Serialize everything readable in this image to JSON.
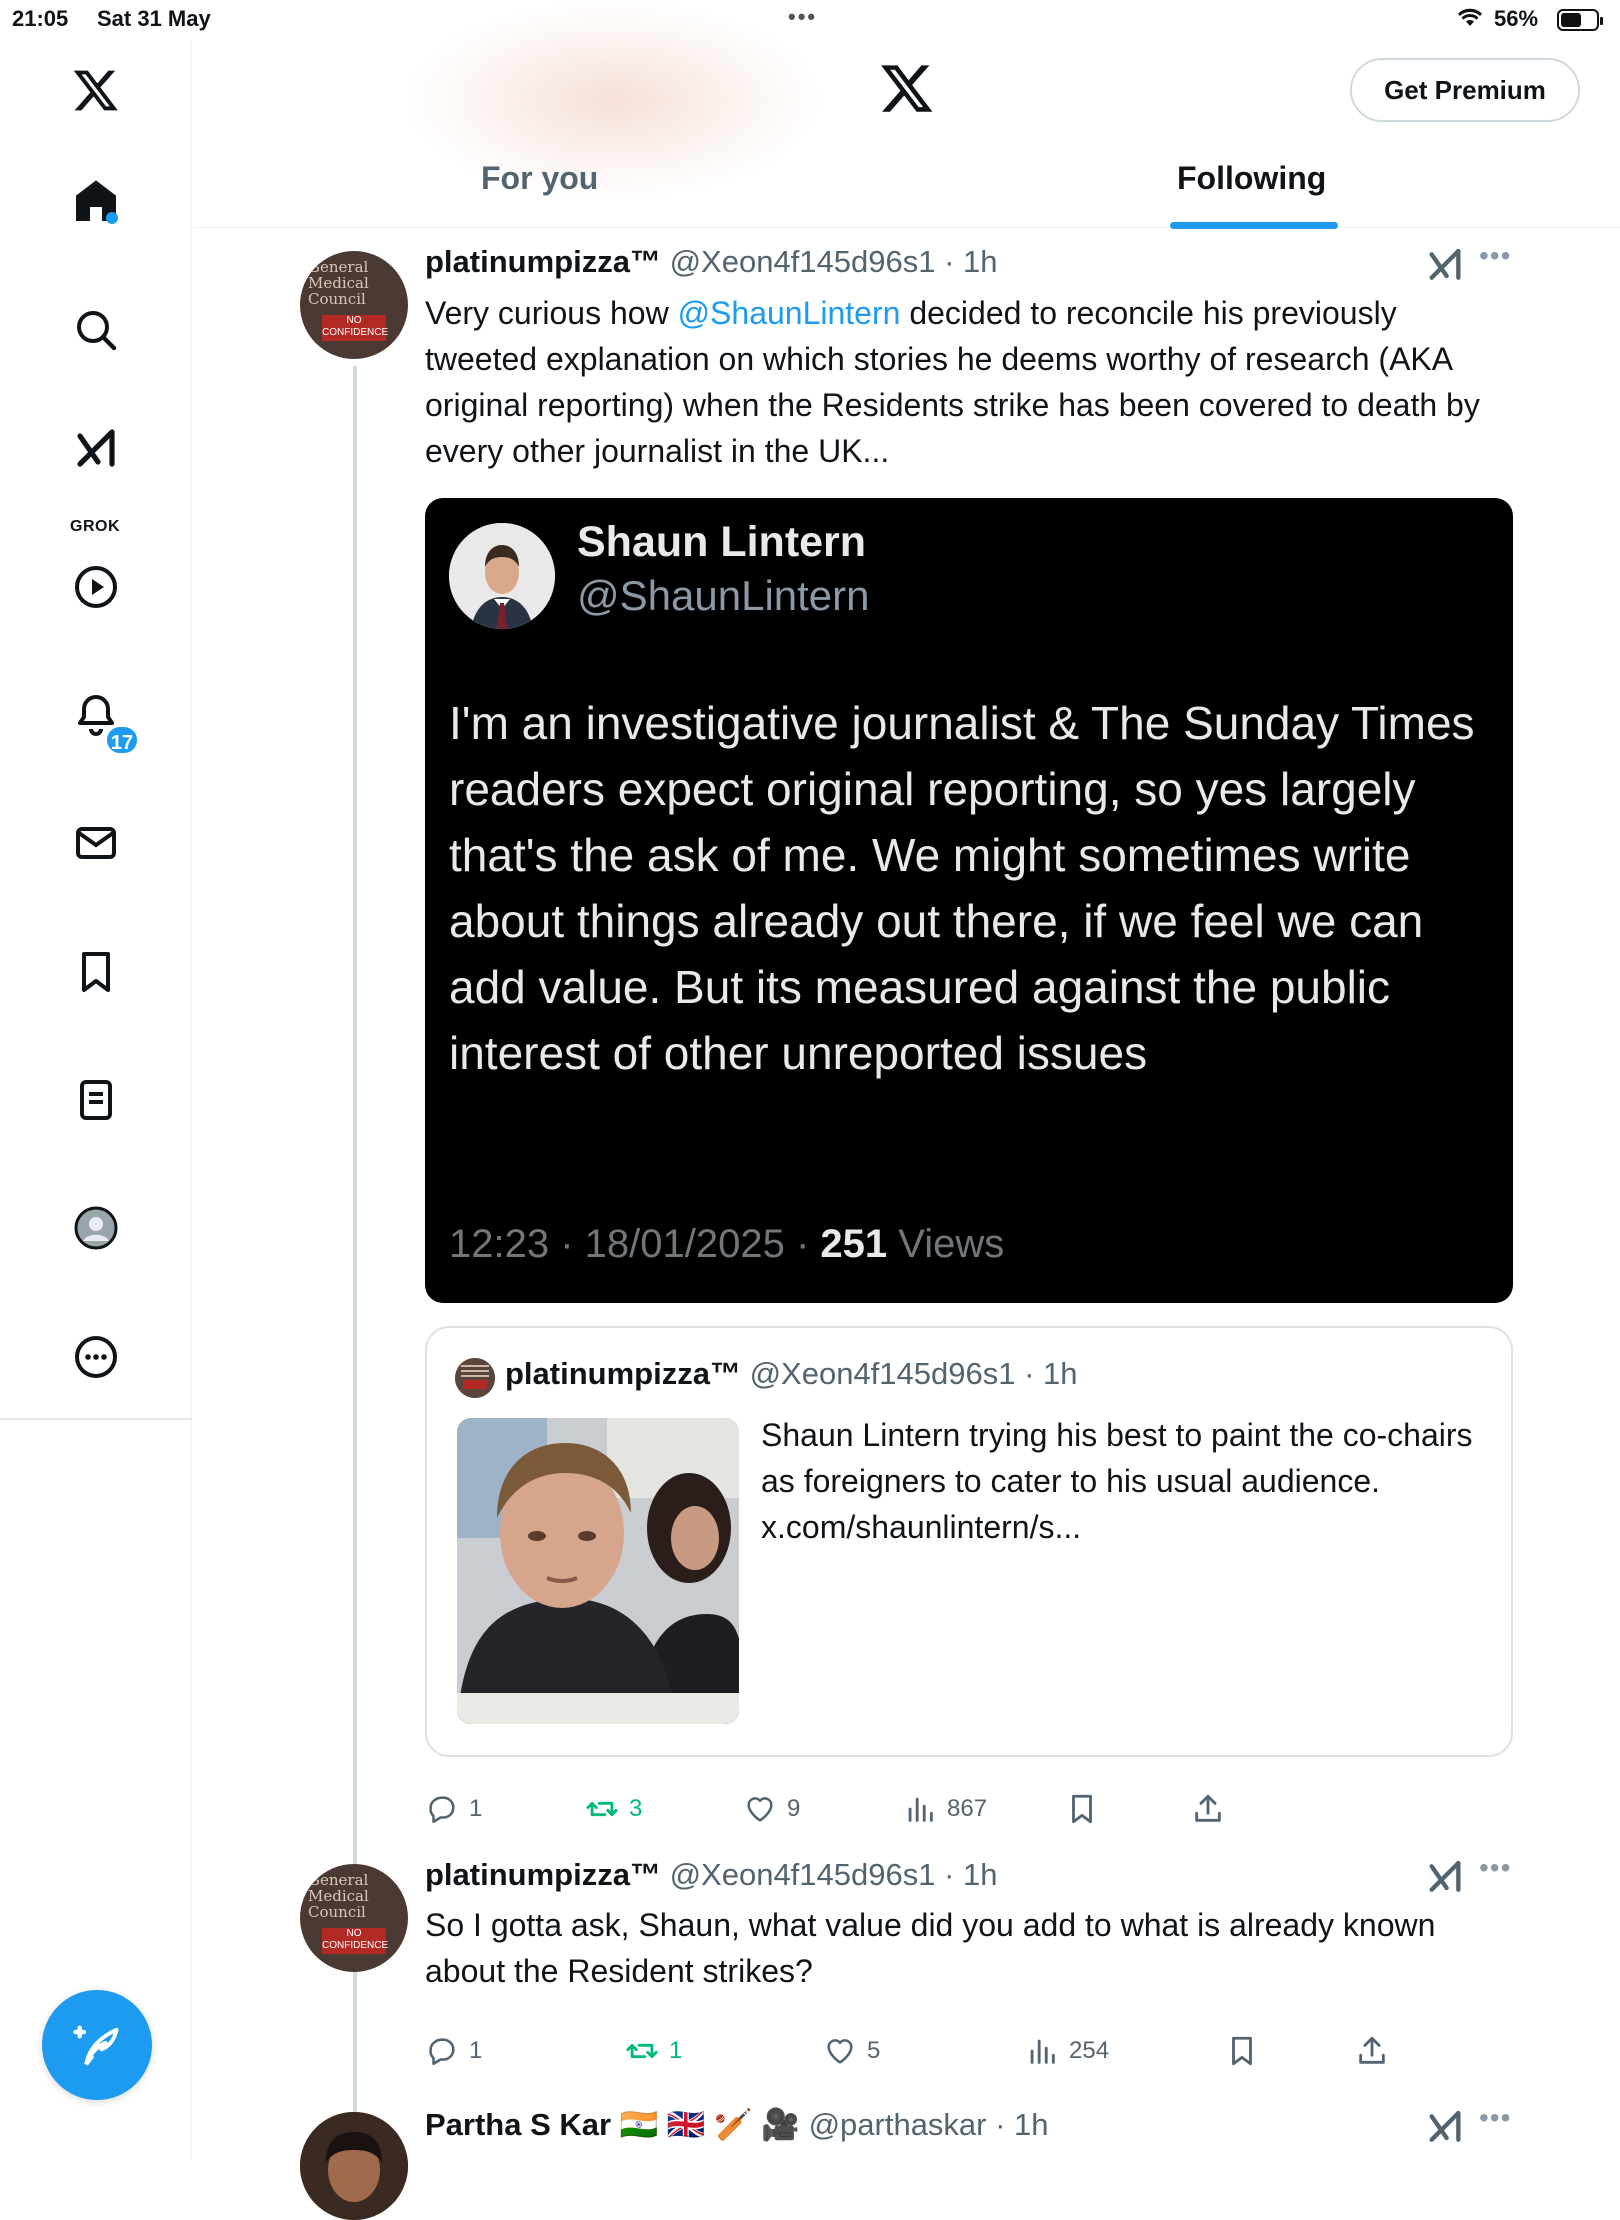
{
  "status": {
    "time": "21:05",
    "date": "Sat 31 May",
    "battery": "56%"
  },
  "sidebar": {
    "items": [
      {
        "name": "home",
        "icon": "home-icon"
      },
      {
        "name": "explore",
        "icon": "search-icon"
      },
      {
        "name": "grok",
        "icon": "grok-icon",
        "label": "GROK"
      },
      {
        "name": "video",
        "icon": "play-icon"
      },
      {
        "name": "notifications",
        "icon": "bell-icon",
        "badge": "17"
      },
      {
        "name": "messages",
        "icon": "envelope-icon"
      },
      {
        "name": "bookmarks",
        "icon": "bookmark-icon"
      },
      {
        "name": "lists",
        "icon": "list-icon"
      },
      {
        "name": "profile",
        "icon": "profile-icon"
      },
      {
        "name": "more",
        "icon": "more-circle-icon"
      }
    ]
  },
  "header": {
    "premium_label": "Get Premium",
    "tabs": [
      {
        "label": "For you"
      },
      {
        "label": "Following"
      }
    ],
    "active_tab": "Following"
  },
  "colors": {
    "accent": "#1d9bf0",
    "retweet": "#00ba7c",
    "muted": "#536471"
  },
  "tweets": [
    {
      "name": "platinumpizza™",
      "handle": "@Xeon4f145d96s1",
      "time": "· 1h",
      "text_before": "Very curious how ",
      "mention": "@ShaunLintern",
      "text_after": " decided to reconcile his previously tweeted explanation on which stories he deems worthy of research (AKA original reporting) when the Residents strike has been covered to death by every other journalist in the UK...",
      "screenshot": {
        "name": "Shaun Lintern",
        "handle": "@ShaunLintern",
        "text": "I'm an investigative journalist & The Sunday Times readers expect original reporting, so yes largely that's the ask of me. We might sometimes write about things already out there, if we feel we can add value. But its measured against the public interest of other unreported issues",
        "meta_prefix": "12:23 · 18/01/2025 · ",
        "views_count": "251",
        "views_label": " Views"
      },
      "quote": {
        "name": "platinumpizza™",
        "handle": "@Xeon4f145d96s1",
        "time": "· 1h",
        "text": "Shaun Lintern trying his best to paint the co-chairs as foreigners to cater to his usual audience. x.com/shaunlintern/s..."
      },
      "replies": "1",
      "retweets": "3",
      "likes": "9",
      "views": "867"
    },
    {
      "name": "platinumpizza™",
      "handle": "@Xeon4f145d96s1",
      "time": "· 1h",
      "text": "So I gotta ask, Shaun, what value did you add to what is already known about the Resident strikes?",
      "replies": "1",
      "retweets": "1",
      "likes": "5",
      "views": "254"
    },
    {
      "name": "Partha S Kar",
      "emoji": "🇮🇳 🇬🇧 🏏 🎥",
      "handle": "@parthaskar",
      "time": "· 1h"
    }
  ],
  "avatar_text": {
    "org": "General Medical Council",
    "stamp": "NO CONFIDENCE"
  }
}
